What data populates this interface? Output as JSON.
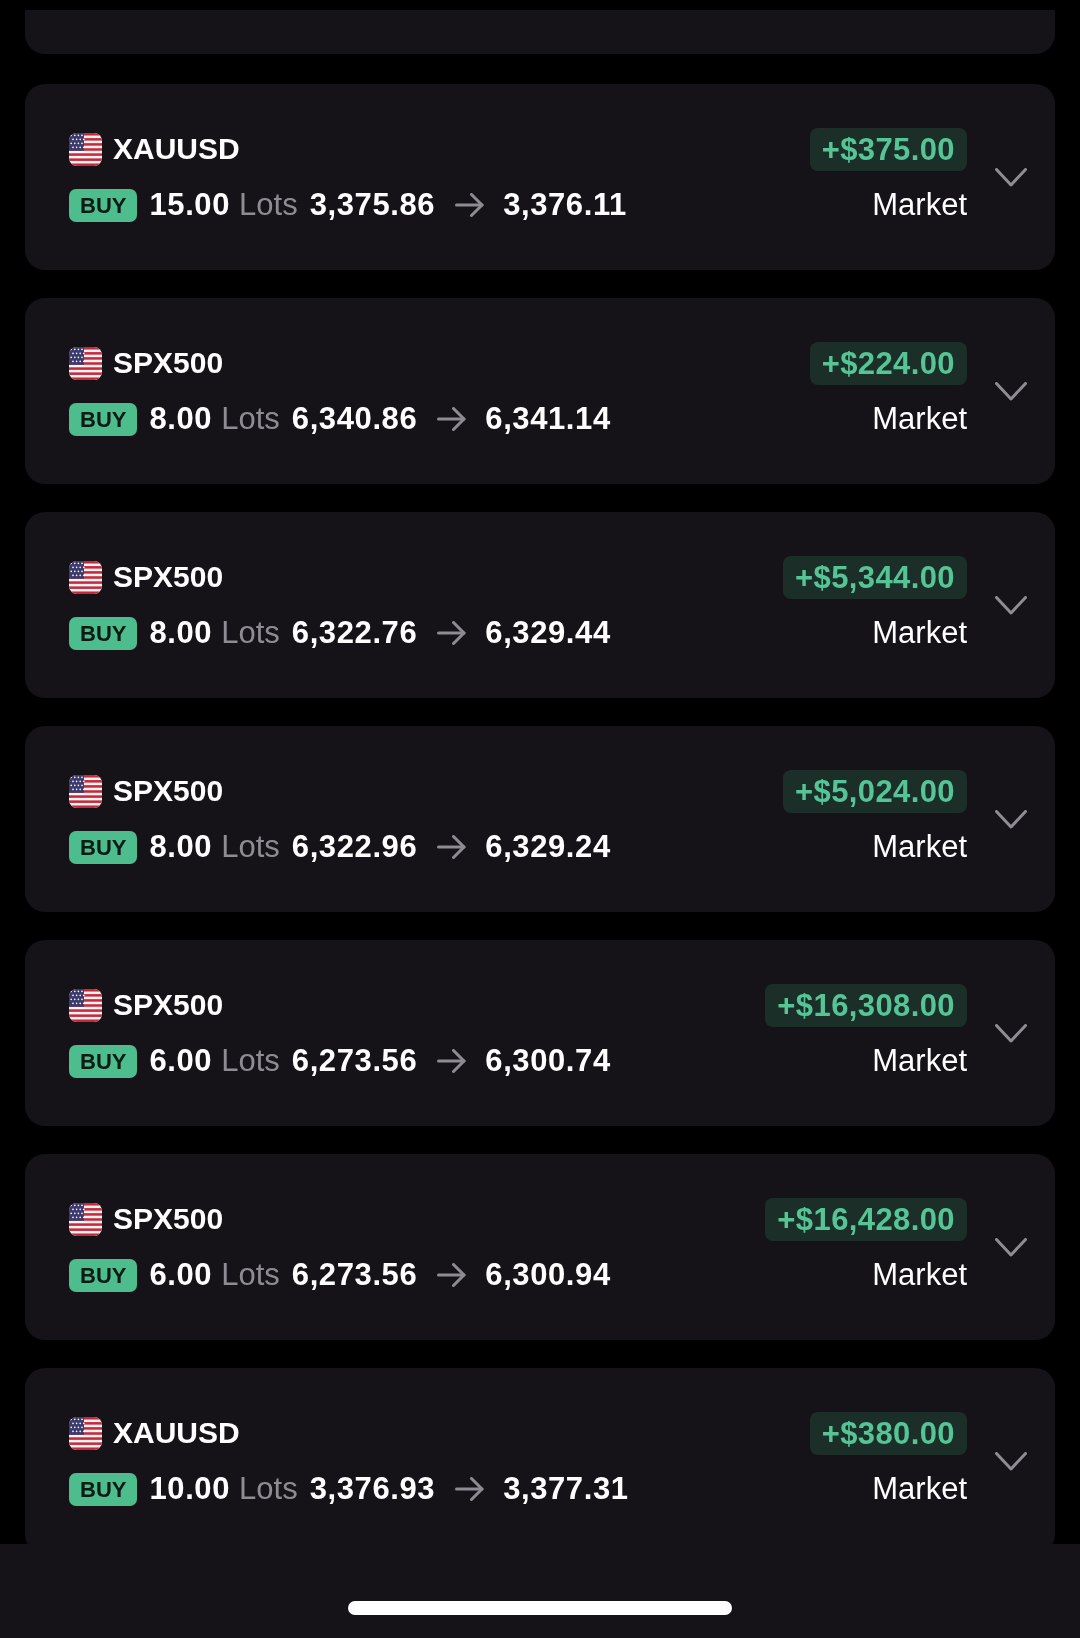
{
  "positions": [
    {
      "symbol": "XAUUSD",
      "side": "BUY",
      "lots": "15.00",
      "lots_unit": "Lots",
      "open_price": "3,375.86",
      "current_price": "3,376.11",
      "pnl": "+$375.00",
      "order_type": "Market",
      "expanded": false
    },
    {
      "symbol": "SPX500",
      "side": "BUY",
      "lots": "8.00",
      "lots_unit": "Lots",
      "open_price": "6,340.86",
      "current_price": "6,341.14",
      "pnl": "+$224.00",
      "order_type": "Market",
      "expanded": false
    },
    {
      "symbol": "SPX500",
      "side": "BUY",
      "lots": "8.00",
      "lots_unit": "Lots",
      "open_price": "6,322.76",
      "current_price": "6,329.44",
      "pnl": "+$5,344.00",
      "order_type": "Market",
      "expanded": false
    },
    {
      "symbol": "SPX500",
      "side": "BUY",
      "lots": "8.00",
      "lots_unit": "Lots",
      "open_price": "6,322.96",
      "current_price": "6,329.24",
      "pnl": "+$5,024.00",
      "order_type": "Market",
      "expanded": false
    },
    {
      "symbol": "SPX500",
      "side": "BUY",
      "lots": "6.00",
      "lots_unit": "Lots",
      "open_price": "6,273.56",
      "current_price": "6,300.74",
      "pnl": "+$16,308.00",
      "order_type": "Market",
      "expanded": false
    },
    {
      "symbol": "SPX500",
      "side": "BUY",
      "lots": "6.00",
      "lots_unit": "Lots",
      "open_price": "6,273.56",
      "current_price": "6,300.94",
      "pnl": "+$16,428.00",
      "order_type": "Market",
      "expanded": false
    },
    {
      "symbol": "XAUUSD",
      "side": "BUY",
      "lots": "10.00",
      "lots_unit": "Lots",
      "open_price": "3,376.93",
      "current_price": "3,377.31",
      "pnl": "+$380.00",
      "order_type": "Market",
      "expanded": false
    }
  ]
}
